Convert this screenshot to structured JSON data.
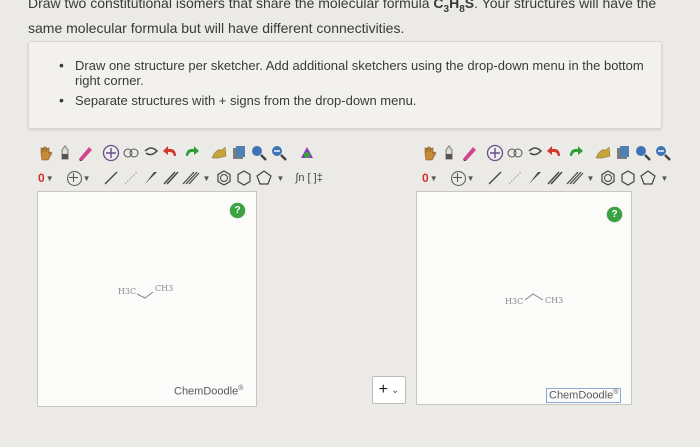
{
  "question": {
    "line1_pre": "Draw two constitutional isomers that share the molecular formula ",
    "formula_C": "C",
    "formula_C_sub": "3",
    "formula_H": "H",
    "formula_H_sub": "8",
    "formula_S": "S",
    "line1_post": ". Your structures will have the",
    "line2": "same molecular formula but will have different connectivities."
  },
  "instructions": [
    "Draw one structure per sketcher. Add additional sketchers using the drop-down menu in the bottom right corner.",
    "Separate structures with + signs from the drop-down menu."
  ],
  "sketchers": [
    {
      "help_label": "?",
      "charge_value": "0",
      "template_label": "∫n [ ]‡",
      "molecule_left": "H3C",
      "molecule_right": "CH3",
      "brand": "ChemDoodle",
      "brand_mark": "®"
    },
    {
      "help_label": "?",
      "charge_value": "0",
      "molecule_left": "H3C",
      "molecule_right": "CH3",
      "brand": "ChemDoodle",
      "brand_mark": "®"
    }
  ],
  "separator": {
    "value": "+",
    "chevron": "⌄"
  },
  "colors": {
    "help_green": "#3aa341",
    "charge_red": "#cc3333",
    "toolbar_accent": "#8a3ab9"
  },
  "icons": [
    "hand-icon",
    "eraser-icon",
    "pencil-icon",
    "ring-icon",
    "chain-icon",
    "undo-icon",
    "redo-icon",
    "clean-icon",
    "copy-icon",
    "zoom-in-icon",
    "zoom-out-icon",
    "atom-icon"
  ]
}
